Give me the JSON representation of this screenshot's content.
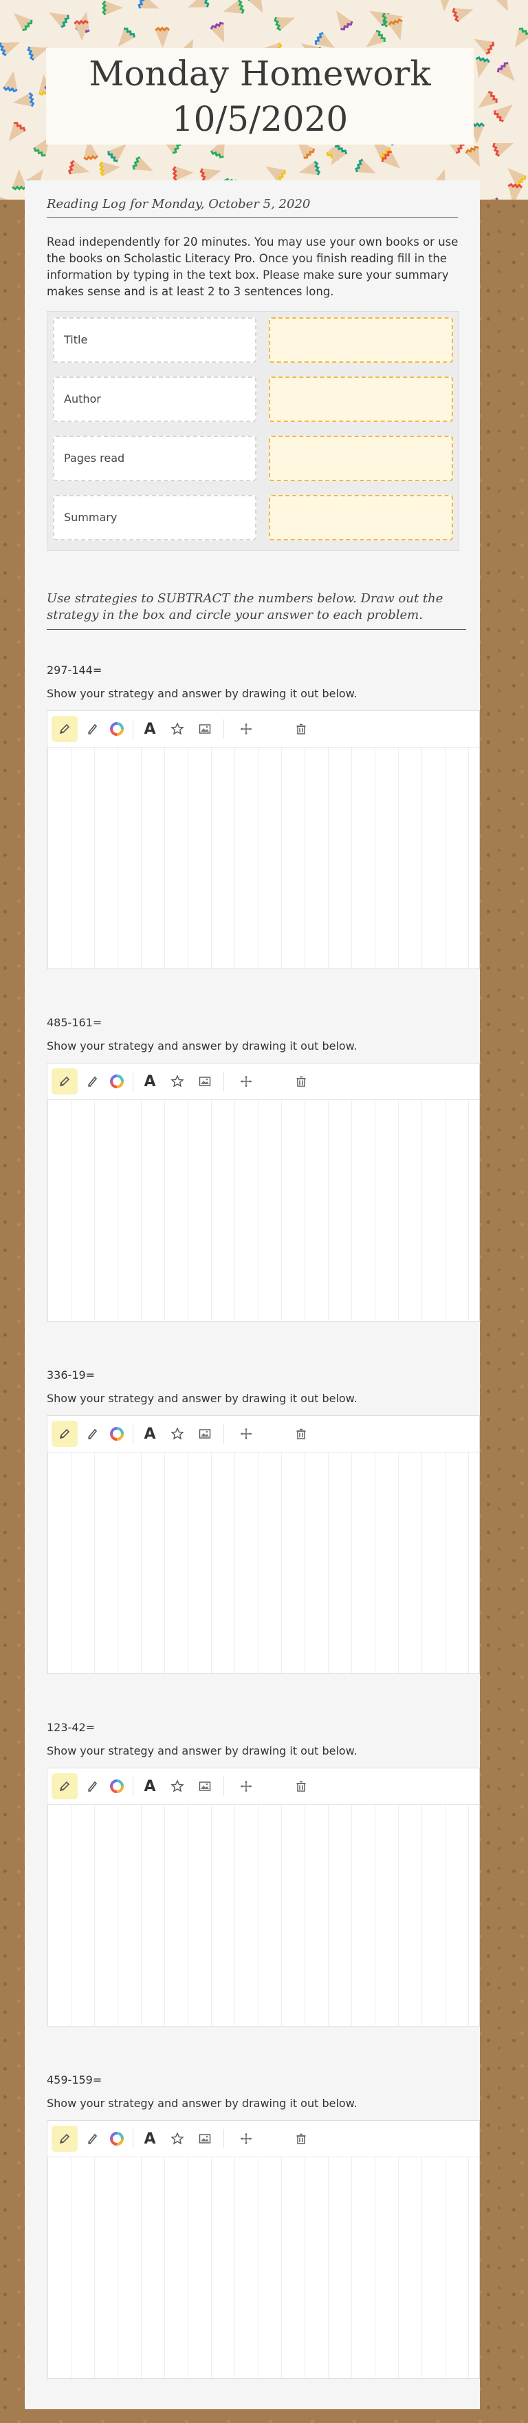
{
  "header": {
    "title_line1": "Monday Homework",
    "title_line2": "10/5/2020"
  },
  "reading_log": {
    "heading": "Reading Log for Monday, October 5, 2020",
    "instructions": "Read independently for 20 minutes.  You may use your own books or use the books on Scholastic Literacy Pro.  Once you finish reading fill in the information by typing in the text box.  Please make sure your summary makes sense and is at least 2 to 3 sentences long.",
    "rows": [
      {
        "label": "Title",
        "value": ""
      },
      {
        "label": "Author",
        "value": ""
      },
      {
        "label": "Pages read",
        "value": ""
      },
      {
        "label": "Summary",
        "value": ""
      }
    ]
  },
  "subtraction": {
    "directions": "Use strategies to SUBTRACT the numbers below.  Draw out the strategy in the box and circle your answer to each problem.",
    "instruction": "Show your strategy and answer by drawing it out below.",
    "problems": [
      "297-144=",
      "485-161=",
      "336-19=",
      "123-42=",
      "459-159="
    ]
  },
  "toolbar": {
    "tools": [
      "pencil-icon",
      "marker-icon",
      "color-wheel-icon",
      "text-tool-icon",
      "star-icon",
      "image-icon",
      "move-icon",
      "trash-icon"
    ],
    "text_tool_glyph": "A",
    "active_tool": "pencil-icon",
    "active_color": "#fbf2b8"
  },
  "colors": {
    "background": "#a47c4f",
    "sheet": "#f5f5f5",
    "input_fill": "#fff7df",
    "input_border": "#f0b84c"
  }
}
